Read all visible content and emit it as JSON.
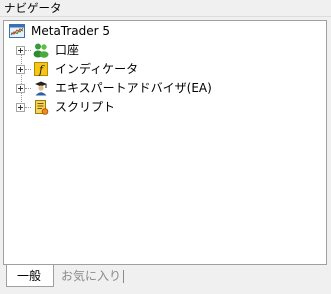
{
  "window": {
    "title": "ナビゲータ"
  },
  "tree": {
    "root": {
      "label": "MetaTrader 5",
      "icon": "terminal-icon"
    },
    "nodes": [
      {
        "label": "口座",
        "icon": "accounts-icon"
      },
      {
        "label": "インディケータ",
        "icon": "indicator-icon"
      },
      {
        "label": "エキスパートアドバイザ(EA)",
        "icon": "expert-advisor-icon"
      },
      {
        "label": "スクリプト",
        "icon": "script-icon"
      }
    ]
  },
  "tabs": [
    {
      "label": "一般",
      "active": true
    },
    {
      "label": "お気に入り",
      "active": false
    }
  ]
}
